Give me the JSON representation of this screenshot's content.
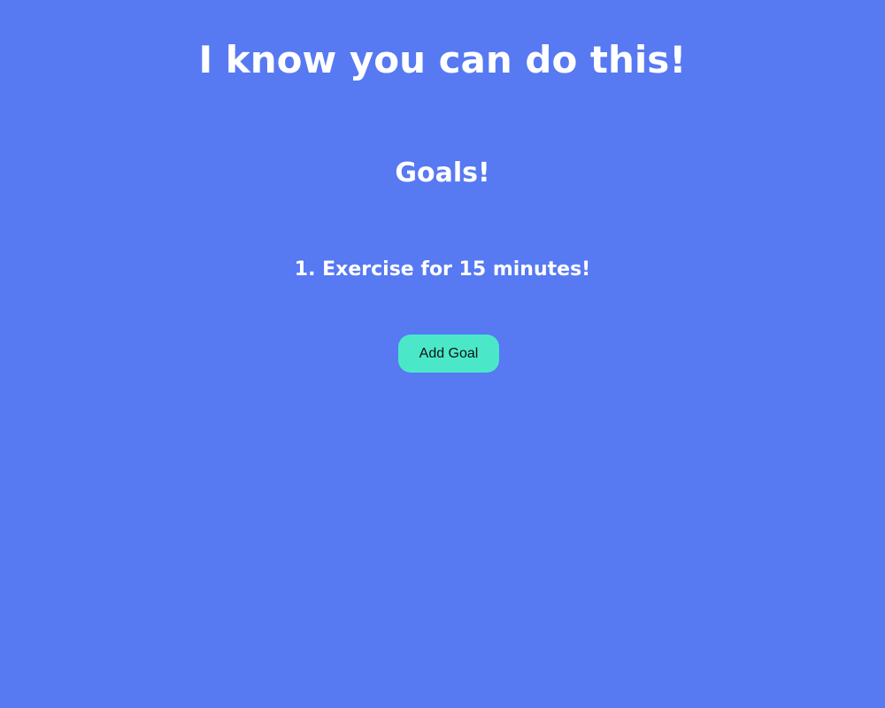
{
  "header": {
    "headline": "I know you can do this!"
  },
  "goals": {
    "title": "Goals!",
    "items": [
      {
        "label": "1. Exercise for 15 minutes!"
      }
    ],
    "add_button_label": "Add Goal"
  },
  "colors": {
    "background": "#5779f2",
    "text": "#ffffff",
    "button": "#4ae8c9"
  }
}
